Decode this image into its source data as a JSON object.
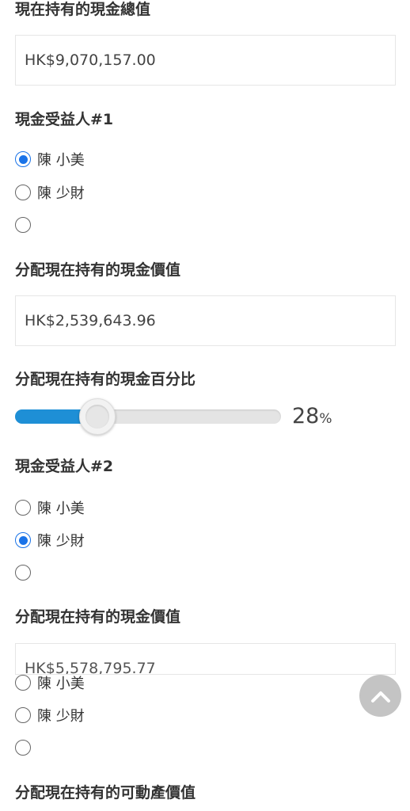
{
  "total_cash": {
    "title": "現在持有的現金總值",
    "value": "HK$9,070,157.00"
  },
  "beneficiary1": {
    "title": "現金受益人#1",
    "options": [
      "陳 小美",
      "陳 少財",
      ""
    ],
    "selected_index": 0,
    "alloc_value_title": "分配現在持有的現金價值",
    "alloc_value": "HK$2,539,643.96",
    "percent_title": "分配現在持有的現金百分比",
    "percent_value": "28",
    "percent_unit": "%",
    "percent_fraction": 0.28
  },
  "beneficiary2": {
    "title": "現金受益人#2",
    "options": [
      "陳 小美",
      "陳 少財",
      ""
    ],
    "selected_index": 1,
    "alloc_value_title": "分配現在持有的現金價值",
    "alloc_value": "HK$5,578,795.77"
  },
  "extra_options": {
    "options": [
      "陳 小美",
      "陳 少財",
      ""
    ]
  },
  "movable_assets": {
    "title": "分配現在持有的可動產價值"
  },
  "colors": {
    "accent": "#1a73e8",
    "slider_fill": "#1e8fd6",
    "scroll_button": "#c4c4c4"
  },
  "icons": {
    "scroll_top": "chevron-up-icon"
  }
}
